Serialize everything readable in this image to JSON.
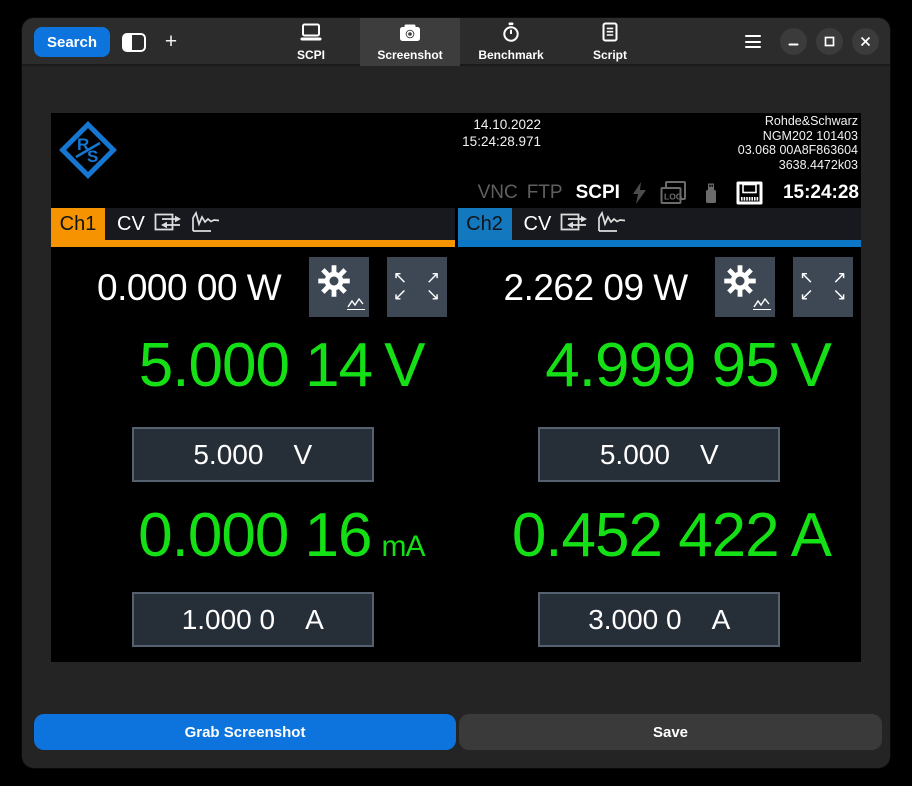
{
  "colors": {
    "accent_blue": "#0d74dd",
    "ch1_orange": "#f59300",
    "ch2_blue": "#1478be",
    "reading_green": "#15e015"
  },
  "titlebar": {
    "search_label": "Search",
    "tabs": [
      {
        "label": "SCPI",
        "icon": "scpi-display-icon"
      },
      {
        "label": "Screenshot",
        "icon": "camera-icon",
        "selected": true
      },
      {
        "label": "Benchmark",
        "icon": "stopwatch-icon"
      },
      {
        "label": "Script",
        "icon": "script-icon"
      }
    ]
  },
  "instrument": {
    "date": "14.10.2022",
    "timestamp": "15:24:28.971",
    "device_info": {
      "brand": "Rohde&Schwarz",
      "model": "NGM202 101403",
      "firmware": "03.068 00A8F863604",
      "serial": "3638.4472k03"
    },
    "status_bar": {
      "vnc": "VNC",
      "ftp": "FTP",
      "scpi": "SCPI",
      "clock": "15:24:28"
    },
    "channels": [
      {
        "name": "Ch1",
        "mode": "CV",
        "power": "0.000 00 W",
        "voltage_reading": "5.000 14",
        "voltage_unit": "V",
        "voltage_setpoint": "5.000",
        "voltage_setpoint_unit": "V",
        "current_reading": "0.000 16",
        "current_unit": "mA",
        "current_unit_class": "unit-small",
        "current_setpoint": "1.000 0",
        "current_setpoint_unit": "A"
      },
      {
        "name": "Ch2",
        "mode": "CV",
        "power": "2.262 09 W",
        "voltage_reading": "4.999 95",
        "voltage_unit": "V",
        "voltage_setpoint": "5.000",
        "voltage_setpoint_unit": "V",
        "current_reading": "0.452 422",
        "current_unit": "A",
        "current_unit_class": "unit-large",
        "current_setpoint": "3.000 0",
        "current_setpoint_unit": "A"
      }
    ]
  },
  "footer": {
    "grab_label": "Grab Screenshot",
    "save_label": "Save"
  }
}
